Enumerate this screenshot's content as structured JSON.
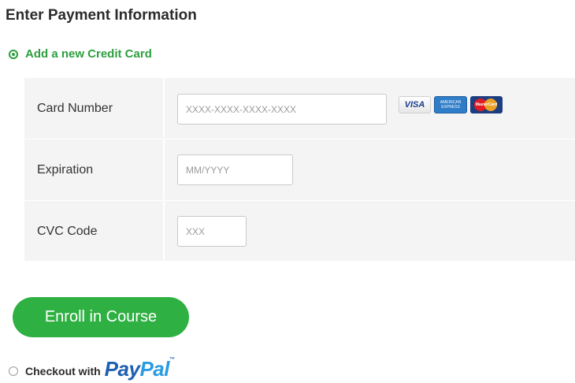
{
  "page": {
    "title": "Enter Payment Information"
  },
  "add_card_option": {
    "label": "Add a new Credit Card",
    "selected": true
  },
  "form": {
    "card_number": {
      "label": "Card Number",
      "placeholder": "XXXX-XXXX-XXXX-XXXX",
      "value": ""
    },
    "expiration": {
      "label": "Expiration",
      "placeholder": "MM/YYYY",
      "value": ""
    },
    "cvc": {
      "label": "CVC Code",
      "placeholder": "XXX",
      "value": ""
    },
    "card_logos": {
      "visa": "VISA",
      "amex_line1": "AMERICAN",
      "amex_line2": "EXPRESS",
      "mastercard": "MasterCard"
    }
  },
  "enroll_button": {
    "label": "Enroll in Course"
  },
  "paypal_option": {
    "label": "Checkout with",
    "logo_pay": "Pay",
    "logo_pal": "Pal",
    "logo_tm": "™",
    "selected": false
  },
  "colors": {
    "accent_green": "#2e9e3f",
    "button_green": "#2fb043",
    "paypal_dark_blue": "#1d5fb1",
    "paypal_light_blue": "#2a9ce0",
    "form_background": "#f4f4f4"
  }
}
